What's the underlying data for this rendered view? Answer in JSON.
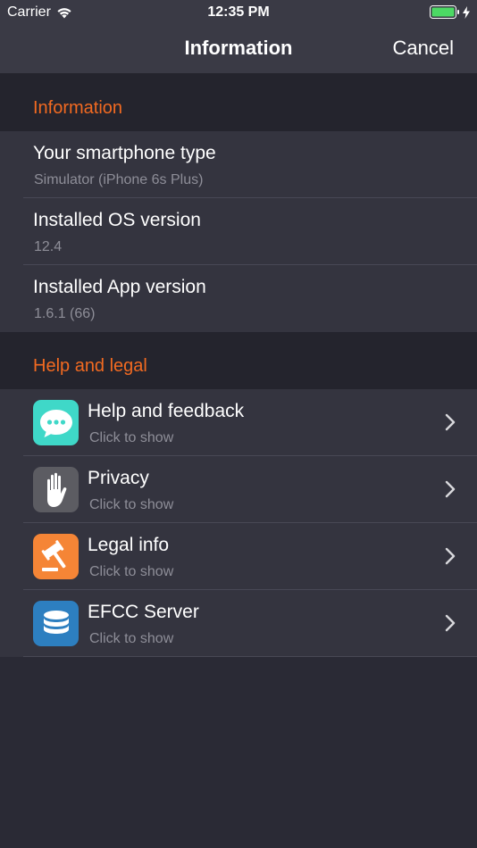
{
  "status_bar": {
    "carrier": "Carrier",
    "time": "12:35 PM",
    "battery_color": "#4cd964"
  },
  "nav": {
    "title": "Information",
    "cancel_label": "Cancel"
  },
  "sections": {
    "information": {
      "header": "Information",
      "rows": [
        {
          "title": "Your smartphone type",
          "value": "Simulator (iPhone 6s Plus)"
        },
        {
          "title": "Installed OS version",
          "value": "12.4"
        },
        {
          "title": "Installed App version",
          "value": "1.6.1 (66)"
        }
      ]
    },
    "help": {
      "header": "Help and legal",
      "rows": [
        {
          "title": "Help and feedback",
          "subtitle": "Click to show",
          "icon": "chat-bubble-icon",
          "icon_color": "#3fd8c8"
        },
        {
          "title": "Privacy",
          "subtitle": "Click to show",
          "icon": "hand-stop-icon",
          "icon_color": "#5c5c62"
        },
        {
          "title": "Legal info",
          "subtitle": "Click to show",
          "icon": "gavel-icon",
          "icon_color": "#f58536"
        },
        {
          "title": "EFCC Server",
          "subtitle": "Click to show",
          "icon": "database-icon",
          "icon_color": "#2d7fc0"
        }
      ]
    }
  },
  "colors": {
    "accent": "#f26a21",
    "background": "#2a2a35",
    "row_background": "#34343f",
    "bar_background": "#3a3a45"
  }
}
